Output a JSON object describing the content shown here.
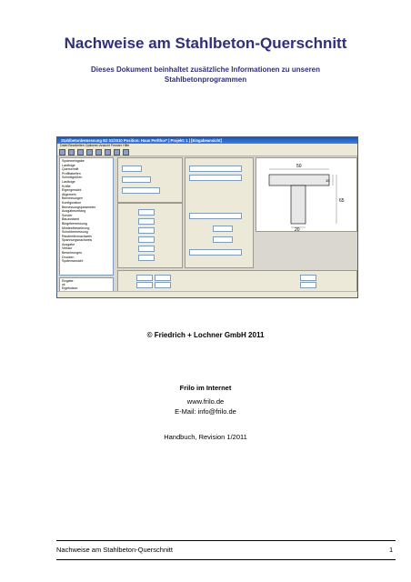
{
  "document": {
    "title": "Nachweise am Stahlbeton-Querschnitt",
    "subtitle_line1": "Dieses Dokument beinhaltet zusätzliche Informationen zu unseren",
    "subtitle_line2": "Stahlbetonprogrammen",
    "copyright": "© Friedrich + Lochner GmbH 2011",
    "internet_heading": "Frilo im Internet",
    "website": "www.frilo.de",
    "email": "E-Mail: info@frilo.de",
    "revision": "Handbuch, Revision 1/2011",
    "footer_title": "Nachweise am Stahlbeton-Querschnitt",
    "page_number": "1"
  },
  "screenshot": {
    "window_title": "Stahlbetonbemessung B2 01/2010  Position: Haus Perlthor* | Projekt: 1 | [Eingabeansicht]",
    "menu": "Datei  Bearbeiten  Optionen  Ansicht  Fenster  Hilfe",
    "tree_items": [
      "Systemeingabe",
      "Lastfolge",
      "Querschnitt",
      "Profiltabellen",
      "Schnittgrößen",
      "Lastfolge",
      "Kräfte",
      "Eigengewicht",
      "Allgemein",
      "Bemessungen",
      "Konfiguration",
      "Bemessungsparameter",
      "Ausgabeumfang",
      "Sonder",
      "Bauzustand",
      "Biegebemessung",
      "Mindestbewehrung",
      "Schubbemessung",
      "Rissbreitennachweis",
      "Spannungsnachweis",
      "Ausgabe",
      "Verlauf",
      "Bewehrungen",
      "Drucken",
      "Systemansicht"
    ],
    "lower_items": [
      "Eingabe:",
      "ok",
      "Ergebnisse:",
      "ok"
    ],
    "drawing_labels": [
      "50",
      "20",
      "15",
      "65"
    ]
  }
}
